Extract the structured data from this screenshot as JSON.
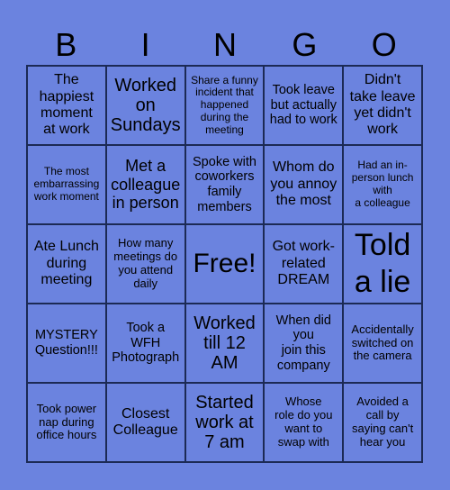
{
  "header": {
    "letters": [
      "B",
      "I",
      "N",
      "G",
      "O"
    ]
  },
  "colors": {
    "background": "#6b83df",
    "grid_line": "#1c2a55",
    "text": "#000000"
  },
  "board": {
    "cells": [
      "The\nhappiest\nmoment\nat work",
      "Worked\non\nSundays",
      "Share a funny\nincident that\nhappened\nduring the\nmeeting",
      "Took leave\nbut actually\nhad to work",
      "Didn't\ntake leave\nyet didn't\nwork",
      "The most\nembarrassing\nwork moment",
      "Met a\ncolleague\nin person",
      "Spoke with\ncoworkers\nfamily\nmembers",
      "Whom do\nyou annoy\nthe most",
      "Had an in-\nperson lunch\nwith\na colleague",
      "Ate Lunch\nduring\nmeeting",
      "How many\nmeetings do\nyou attend\ndaily",
      "Free!",
      "Got work-\nrelated\nDREAM",
      "Told\na lie",
      "MYSTERY\nQuestion!!!",
      "Took a\nWFH\nPhotograph",
      "Worked\ntill 12\nAM",
      "When did\nyou\njoin this\ncompany",
      "Accidentally\nswitched on\nthe camera",
      "Took power\nnap during\noffice hours",
      "Closest\nColleague",
      "Started\nwork at\n7 am",
      "Whose\nrole do you\nwant to\nswap with",
      "Avoided a\ncall by\nsaying can't\nhear you"
    ]
  }
}
